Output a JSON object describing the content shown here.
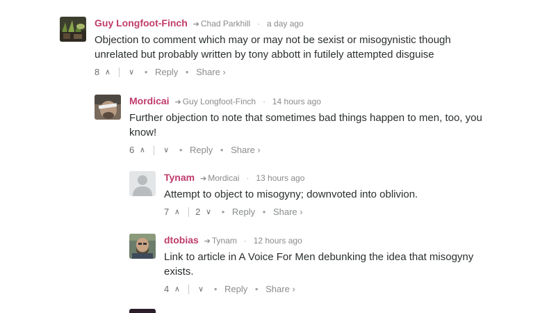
{
  "comments": [
    {
      "author": "Guy Longfoot-Finch",
      "replying_to": "Chad Parkhill",
      "time": "a day ago",
      "text_lines": [
        "Objection to comment which may or may not be sexist or misogynistic though",
        "unrelated but probably written by tony abbott in futilely attempted disguise"
      ],
      "upvotes": "8",
      "downvotes": "",
      "reply_label": "Reply",
      "share_label": "Share ›"
    },
    {
      "author": "Mordicai",
      "replying_to": "Guy Longfoot-Finch",
      "time": "14 hours ago",
      "text_lines": [
        "Further objection to note that sometimes bad things happen to men, too, you",
        "know!"
      ],
      "upvotes": "6",
      "downvotes": "",
      "reply_label": "Reply",
      "share_label": "Share ›"
    },
    {
      "author": "Tynam",
      "replying_to": "Mordicai",
      "time": "13 hours ago",
      "text_lines": [
        "Attempt to object to misogyny; downvoted into oblivion."
      ],
      "upvotes": "7",
      "downvotes": "2",
      "reply_label": "Reply",
      "share_label": "Share ›"
    },
    {
      "author": "dtobias",
      "replying_to": "Tynam",
      "time": "12 hours ago",
      "text_lines": [
        "Link to article in A Voice For Men debunking the idea that misogyny",
        "exists."
      ],
      "upvotes": "4",
      "downvotes": "",
      "reply_label": "Reply",
      "share_label": "Share ›"
    }
  ],
  "icons": {
    "reply_arrow": "reply-arrow-icon",
    "upvote": "chevron-up-icon",
    "downvote": "chevron-down-icon"
  }
}
